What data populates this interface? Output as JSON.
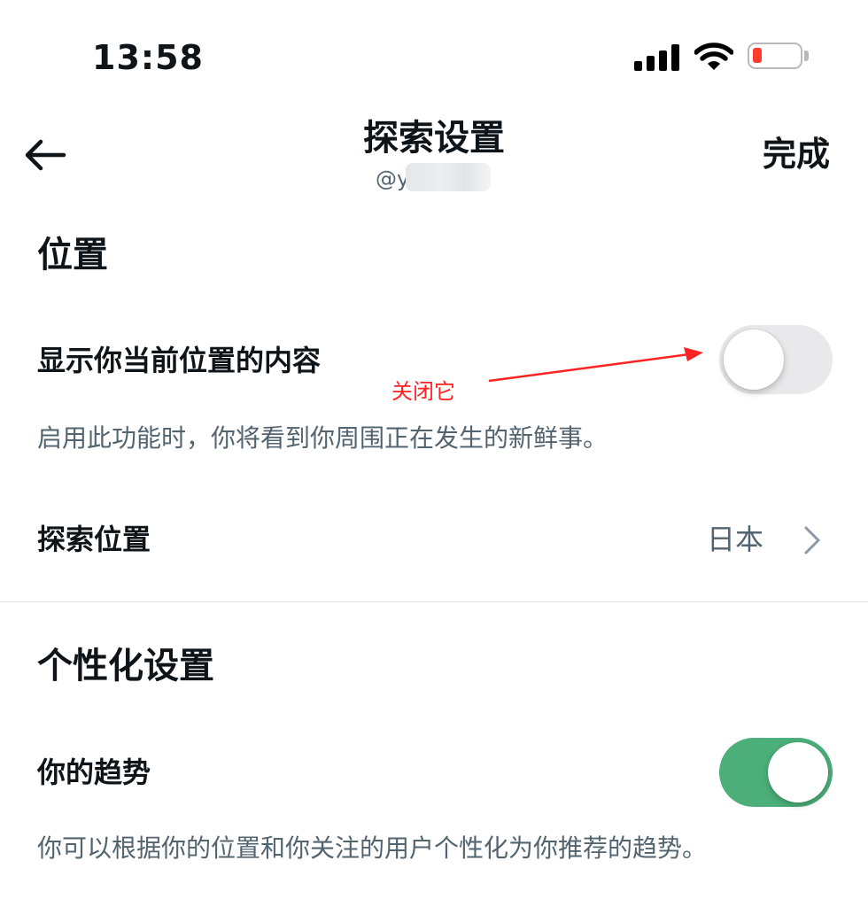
{
  "status_bar": {
    "time": "13:58"
  },
  "header": {
    "title": "探索设置",
    "handle": "@y",
    "done_label": "完成"
  },
  "location_section": {
    "heading": "位置",
    "show_current_location": {
      "label": "显示你当前位置的内容",
      "enabled": false,
      "description": "启用此功能时，你将看到你周围正在发生的新鲜事。"
    },
    "explore_location": {
      "label": "探索位置",
      "value": "日本"
    }
  },
  "annotation": {
    "text": "关闭它",
    "color": "#ff2222"
  },
  "personalization_section": {
    "heading": "个性化设置",
    "your_trends": {
      "label": "你的趋势",
      "enabled": true,
      "description": "你可以根据你的位置和你关注的用户个性化为你推荐的趋势。"
    }
  },
  "colors": {
    "toggle_on": "#4caf7a",
    "toggle_off": "#e9e9eb",
    "secondary_text": "#536471",
    "battery_low": "#ff3b30"
  },
  "icons": {
    "back": "arrow-left-icon",
    "chevron": "chevron-right-icon",
    "signal": "cellular-signal-icon",
    "wifi": "wifi-icon",
    "battery": "battery-icon"
  }
}
